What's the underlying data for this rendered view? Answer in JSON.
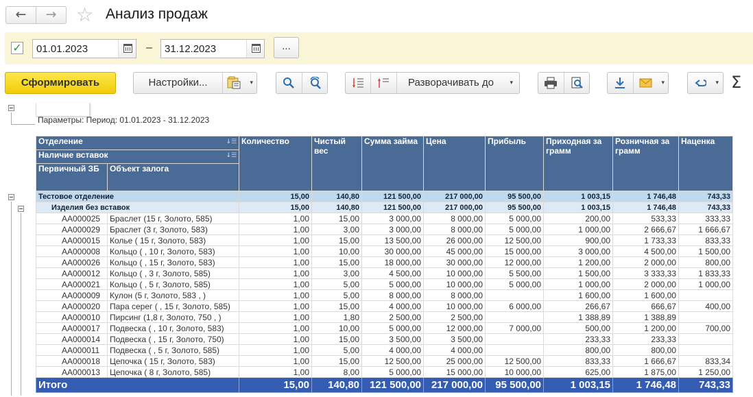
{
  "header": {
    "back_icon": "←",
    "forward_icon": "→",
    "star_icon": "☆",
    "title": "Анализ продаж"
  },
  "period": {
    "enabled_mark": "✓",
    "date_from": "01.01.2023",
    "date_to": "31.12.2023",
    "dash": "–",
    "more_button": "..."
  },
  "toolbar": {
    "generate": "Сформировать",
    "settings": "Настройки...",
    "caret": "▾",
    "expand_to": "Разворачивать до",
    "sigma": "Σ"
  },
  "report": {
    "params_text": "Параметры:  Период: 01.01.2023 - 31.12.2023",
    "headers": {
      "group1": "Отделение",
      "group2": "Наличие вставок",
      "code": "Первичный ЗБ",
      "object": "Объект залога",
      "qty": "Количество",
      "net_weight": "Чистый вес",
      "loan_sum": "Сумма займа",
      "price": "Цена",
      "profit": "Прибыль",
      "buy_per_gram": "Приходная за грамм",
      "retail_per_gram": "Розничная за грамм",
      "markup": "Наценка"
    },
    "dept_row": [
      "Тестовое отделение",
      "15,00",
      "140,80",
      "121 500,00",
      "217 000,00",
      "95 500,00",
      "1 003,15",
      "1 746,48",
      "743,33"
    ],
    "sub_row": [
      "Изделия без вставок",
      "15,00",
      "140,80",
      "121 500,00",
      "217 000,00",
      "95 500,00",
      "1 003,15",
      "1 746,48",
      "743,33"
    ],
    "rows": [
      [
        "AA000025",
        "Браслет (15 г, Золото, 585)",
        "1,00",
        "15,00",
        "3 000,00",
        "8 000,00",
        "5 000,00",
        "200,00",
        "533,33",
        "333,33"
      ],
      [
        "AA000029",
        "Браслет (3 г, Золото, 583)",
        "1,00",
        "3,00",
        "3 000,00",
        "8 000,00",
        "5 000,00",
        "1 000,00",
        "2 666,67",
        "1 666,67"
      ],
      [
        "AA000015",
        "Колье ( 15 г, Золото, 583)",
        "1,00",
        "15,00",
        "13 500,00",
        "26 000,00",
        "12 500,00",
        "900,00",
        "1 733,33",
        "833,33"
      ],
      [
        "AA000008",
        "Кольцо ( , 10 г, Золото, 583)",
        "1,00",
        "10,00",
        "30 000,00",
        "45 000,00",
        "15 000,00",
        "3 000,00",
        "4 500,00",
        "1 500,00"
      ],
      [
        "AA000026",
        "Кольцо ( , 15 г, Золото, 583)",
        "1,00",
        "15,00",
        "18 000,00",
        "30 000,00",
        "12 000,00",
        "1 200,00",
        "2 000,00",
        "800,00"
      ],
      [
        "AA000012",
        "Кольцо ( , 3 г, Золото, 585)",
        "1,00",
        "3,00",
        "4 500,00",
        "10 000,00",
        "5 500,00",
        "1 500,00",
        "3 333,33",
        "1 833,33"
      ],
      [
        "AA000021",
        "Кольцо ( , 5 г, Золото, 585)",
        "1,00",
        "5,00",
        "5 000,00",
        "10 000,00",
        "5 000,00",
        "1 000,00",
        "2 000,00",
        "1 000,00"
      ],
      [
        "AA000009",
        "Кулон (5 г, Золото, 583 , )",
        "1,00",
        "5,00",
        "8 000,00",
        "8 000,00",
        "",
        "1 600,00",
        "1 600,00",
        ""
      ],
      [
        "AA000020",
        "Пара серег ( , 15 г, Золото, 585)",
        "1,00",
        "15,00",
        "4 000,00",
        "10 000,00",
        "6 000,00",
        "266,67",
        "666,67",
        "400,00"
      ],
      [
        "AA000010",
        "Пирсинг (1,8 г, Золото, 750 , )",
        "1,00",
        "1,80",
        "2 500,00",
        "2 500,00",
        "",
        "1 388,89",
        "1 388,89",
        ""
      ],
      [
        "AA000017",
        "Подвеска ( , 10 г, Золото, 583)",
        "1,00",
        "10,00",
        "5 000,00",
        "12 000,00",
        "7 000,00",
        "500,00",
        "1 200,00",
        "700,00"
      ],
      [
        "AA000014",
        "Подвеска ( , 15 г, Золото, 750)",
        "1,00",
        "15,00",
        "3 500,00",
        "3 500,00",
        "",
        "233,33",
        "233,33",
        ""
      ],
      [
        "AA000011",
        "Подвеска ( , 5 г, Золото, 585)",
        "1,00",
        "5,00",
        "4 000,00",
        "4 000,00",
        "",
        "800,00",
        "800,00",
        ""
      ],
      [
        "AA000018",
        "Цепочка ( 15 г, Золото, 583)",
        "1,00",
        "15,00",
        "12 500,00",
        "25 000,00",
        "12 500,00",
        "833,33",
        "1 666,67",
        "833,34"
      ],
      [
        "AA000013",
        "Цепочка ( 8 г, Золото, 585)",
        "1,00",
        "8,00",
        "5 000,00",
        "15 000,00",
        "10 000,00",
        "625,00",
        "1 875,00",
        "1 250,00"
      ]
    ],
    "total_row": [
      "Итого",
      "15,00",
      "140,80",
      "121 500,00",
      "217 000,00",
      "95 500,00",
      "1 003,15",
      "1 746,48",
      "743,33"
    ]
  }
}
